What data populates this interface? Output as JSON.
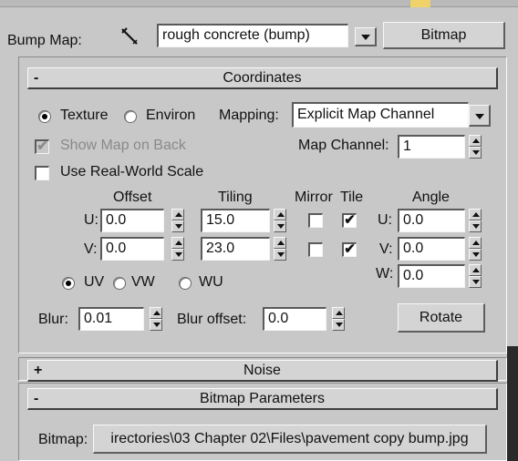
{
  "header": {
    "bump_map_label": "Bump Map:",
    "material_name": "rough concrete (bump)",
    "map_type_button": "Bitmap",
    "eyedropper_icon": "eyedropper-icon"
  },
  "coordinates": {
    "title": "Coordinates",
    "collapse_sign": "-",
    "texture_label": "Texture",
    "environ_label": "Environ",
    "mapping_label": "Mapping:",
    "mapping_value": "Explicit Map Channel",
    "show_map_on_back_label": "Show Map on Back",
    "show_map_on_back_checked": true,
    "map_channel_label": "Map Channel:",
    "map_channel_value": "1",
    "use_real_world_label": "Use Real-World Scale",
    "use_real_world_checked": false,
    "offset_header": "Offset",
    "tiling_header": "Tiling",
    "mirror_header": "Mirror",
    "tile_header": "Tile",
    "angle_header": "Angle",
    "u_label": "U:",
    "v_label": "V:",
    "w_label": "W:",
    "offset_u": "0.0",
    "offset_v": "0.0",
    "tiling_u": "15.0",
    "tiling_v": "23.0",
    "mirror_u": false,
    "mirror_v": false,
    "tile_u": true,
    "tile_v": true,
    "angle_u": "0.0",
    "angle_v": "0.0",
    "angle_w": "0.0",
    "uv_label": "UV",
    "vw_label": "VW",
    "wu_label": "WU",
    "blur_label": "Blur:",
    "blur_value": "0.01",
    "blur_offset_label": "Blur offset:",
    "blur_offset_value": "0.0",
    "rotate_button": "Rotate"
  },
  "noise": {
    "title": "Noise",
    "expand_sign": "+"
  },
  "bitmap_params": {
    "title": "Bitmap Parameters",
    "collapse_sign": "-",
    "bitmap_label": "Bitmap:",
    "bitmap_path": "irectories\\03 Chapter 02\\Files\\pavement copy bump.jpg"
  },
  "check_mark": "✔"
}
